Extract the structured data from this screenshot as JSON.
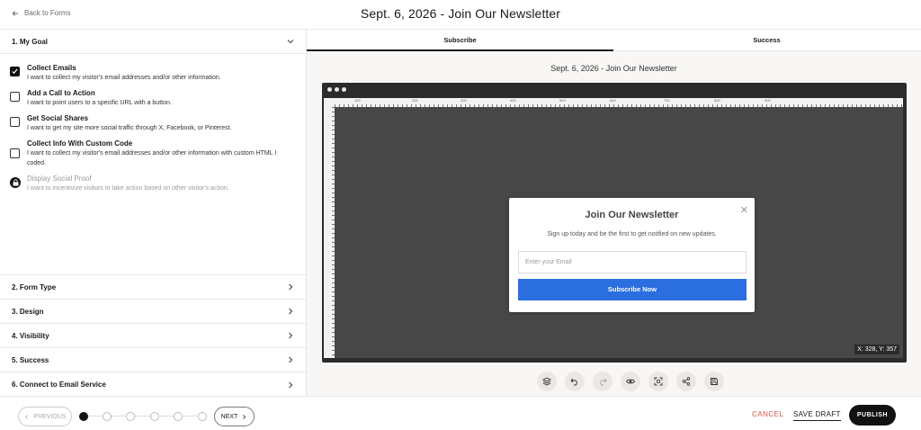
{
  "header": {
    "back_label": "Back to Forms",
    "title": "Sept. 6, 2026 - Join Our Newsletter"
  },
  "left_panel": {
    "goal_section": {
      "label": "1. My Goal",
      "icon": "chevron-down-icon"
    },
    "goals": [
      {
        "title": "Collect Emails",
        "desc": "I want to collect my visitor's email addresses and/or other information.",
        "checked": true
      },
      {
        "title": "Add a Call to Action",
        "desc": "I want to point users to a specific URL with a button.",
        "checked": false
      },
      {
        "title": "Get Social Shares",
        "desc": "I want to get my site more social traffic through X, Facebook, or Pinterest.",
        "checked": false
      },
      {
        "title": "Collect Info With Custom Code",
        "desc": "I want to collect my visitor's email addresses and/or other information with custom HTML I coded.",
        "checked": false
      },
      {
        "title": "Display Social Proof",
        "desc": "I want to incentivize visitors to take action based on other visitor's action.",
        "locked": true
      }
    ],
    "sections": [
      {
        "label": "2. Form Type"
      },
      {
        "label": "3. Design"
      },
      {
        "label": "4. Visibility"
      },
      {
        "label": "5. Success"
      },
      {
        "label": "6. Connect to Email Service"
      }
    ]
  },
  "preview": {
    "tabs": [
      {
        "label": "Subscribe",
        "active": true
      },
      {
        "label": "Success",
        "active": false
      }
    ],
    "title": "Sept. 6, 2026 - Join Our Newsletter",
    "ruler_labels": [
      "100",
      "200",
      "300",
      "400",
      "500",
      "600",
      "700",
      "800",
      "900"
    ],
    "coords": "X: 328, Y: 357",
    "modal": {
      "title": "Join Our Newsletter",
      "close": "✕",
      "subtitle": "Sign up today and be the first to get notified on new updates.",
      "email_placeholder": "Enter your Email",
      "button_label": "Subscribe Now",
      "button_color": "#2a6ee0"
    },
    "toolbar": [
      "layers-icon",
      "undo-icon",
      "redo-icon",
      "eye-icon",
      "fullscreen-icon",
      "share-icon",
      "save-icon"
    ]
  },
  "footer": {
    "previous_label": "PREVIOUS",
    "next_label": "NEXT",
    "step_count": 6,
    "current_step": 1,
    "cancel_label": "CANCEL",
    "save_draft_label": "SAVE DRAFT",
    "publish_label": "PUBLISH",
    "cancel_color": "#d0584a"
  }
}
